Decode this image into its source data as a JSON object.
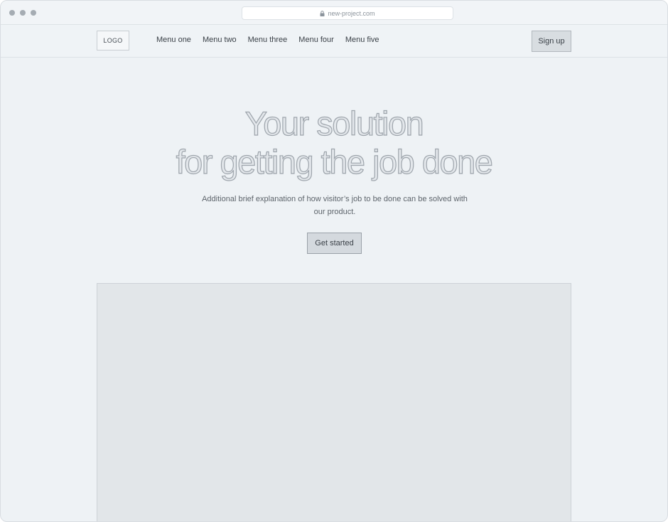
{
  "browser": {
    "url": "new-project.com"
  },
  "header": {
    "logo": "LOGO",
    "menu": [
      "Menu one",
      "Menu two",
      "Menu three",
      "Menu four",
      "Menu five"
    ],
    "signup_label": "Sign up"
  },
  "hero": {
    "title_line1": "Your solution",
    "title_line2": "for getting the job done",
    "subtitle_line1": "Additional brief explanation of how visitor’s job to be done can be solved with",
    "subtitle_line2": "our product.",
    "cta_label": "Get started"
  }
}
